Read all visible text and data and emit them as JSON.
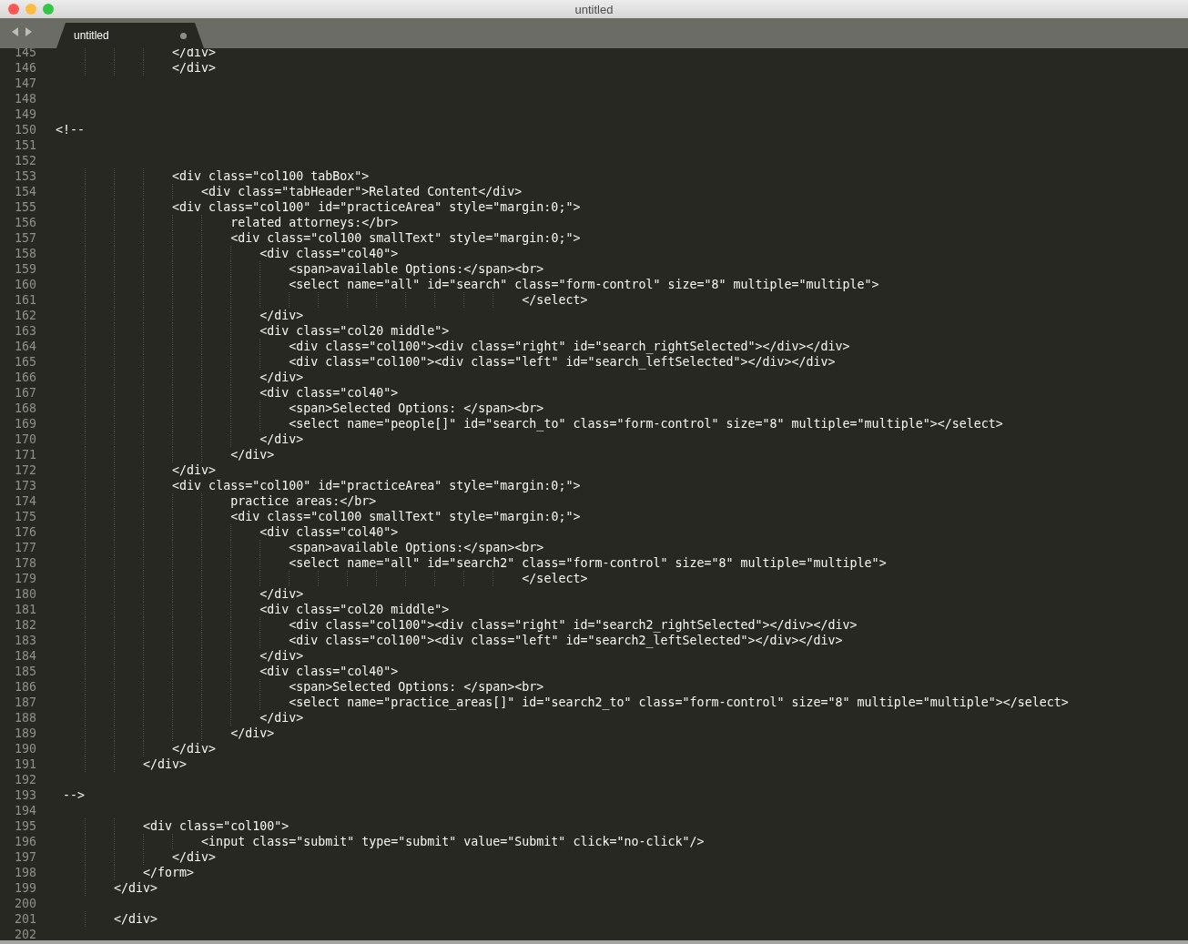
{
  "window": {
    "title": "untitled"
  },
  "tab": {
    "label": "untitled",
    "modified": true,
    "selected": true
  },
  "lines": [
    {
      "number": "145",
      "code": "                </div>"
    },
    {
      "number": "146",
      "code": "                </div>"
    },
    {
      "number": "147"
    },
    {
      "number": "148"
    },
    {
      "number": "149"
    },
    {
      "number": "150",
      "code": "<!--"
    },
    {
      "number": "151"
    },
    {
      "number": "152"
    },
    {
      "number": "153",
      "code": "                <div class=\"col100 tabBox\">"
    },
    {
      "number": "154",
      "code": "                    <div class=\"tabHeader\">Related Content</div>"
    },
    {
      "number": "155",
      "code": "                <div class=\"col100\" id=\"practiceArea\" style=\"margin:0;\">"
    },
    {
      "number": "156",
      "code": "                        related attorneys:</br>"
    },
    {
      "number": "157",
      "code": "                        <div class=\"col100 smallText\" style=\"margin:0;\">"
    },
    {
      "number": "158",
      "code": "                            <div class=\"col40\">"
    },
    {
      "number": "159",
      "code": "                                <span>available Options:</span><br>"
    },
    {
      "number": "160",
      "code": "                                <select name=\"all\" id=\"search\" class=\"form-control\" size=\"8\" multiple=\"multiple\">"
    },
    {
      "number": "161",
      "code": "                                                                </select>"
    },
    {
      "number": "162",
      "code": "                            </div>"
    },
    {
      "number": "163",
      "code": "                            <div class=\"col20 middle\">"
    },
    {
      "number": "164",
      "code": "                                <div class=\"col100\"><div class=\"right\" id=\"search_rightSelected\"></div></div>"
    },
    {
      "number": "165",
      "code": "                                <div class=\"col100\"><div class=\"left\" id=\"search_leftSelected\"></div></div>"
    },
    {
      "number": "166",
      "code": "                            </div>"
    },
    {
      "number": "167",
      "code": "                            <div class=\"col40\">"
    },
    {
      "number": "168",
      "code": "                                <span>Selected Options: </span><br>"
    },
    {
      "number": "169",
      "code": "                                <select name=\"people[]\" id=\"search_to\" class=\"form-control\" size=\"8\" multiple=\"multiple\"></select>"
    },
    {
      "number": "170",
      "code": "                            </div>"
    },
    {
      "number": "171",
      "code": "                        </div>"
    },
    {
      "number": "172",
      "code": "                </div>"
    },
    {
      "number": "173",
      "code": "                <div class=\"col100\" id=\"practiceArea\" style=\"margin:0;\">"
    },
    {
      "number": "174",
      "code": "                        practice areas:</br>"
    },
    {
      "number": "175",
      "code": "                        <div class=\"col100 smallText\" style=\"margin:0;\">"
    },
    {
      "number": "176",
      "code": "                            <div class=\"col40\">"
    },
    {
      "number": "177",
      "code": "                                <span>available Options:</span><br>"
    },
    {
      "number": "178",
      "code": "                                <select name=\"all\" id=\"search2\" class=\"form-control\" size=\"8\" multiple=\"multiple\">"
    },
    {
      "number": "179",
      "code": "                                                                </select>"
    },
    {
      "number": "180",
      "code": "                            </div>"
    },
    {
      "number": "181",
      "code": "                            <div class=\"col20 middle\">"
    },
    {
      "number": "182",
      "code": "                                <div class=\"col100\"><div class=\"right\" id=\"search2_rightSelected\"></div></div>"
    },
    {
      "number": "183",
      "code": "                                <div class=\"col100\"><div class=\"left\" id=\"search2_leftSelected\"></div></div>"
    },
    {
      "number": "184",
      "code": "                            </div>"
    },
    {
      "number": "185",
      "code": "                            <div class=\"col40\">"
    },
    {
      "number": "186",
      "code": "                                <span>Selected Options: </span><br>"
    },
    {
      "number": "187",
      "code": "                                <select name=\"practice_areas[]\" id=\"search2_to\" class=\"form-control\" size=\"8\" multiple=\"multiple\"></select>"
    },
    {
      "number": "188",
      "code": "                            </div>"
    },
    {
      "number": "189",
      "code": "                        </div>"
    },
    {
      "number": "190",
      "code": "                </div>"
    },
    {
      "number": "191",
      "code": "            </div>"
    },
    {
      "number": "192"
    },
    {
      "number": "193",
      "code": " -->"
    },
    {
      "number": "194"
    },
    {
      "number": "195",
      "code": "            <div class=\"col100\">"
    },
    {
      "number": "196",
      "code": "                    <input class=\"submit\" type=\"submit\" value=\"Submit\" click=\"no-click\"/>"
    },
    {
      "number": "197",
      "code": "                </div>"
    },
    {
      "number": "198",
      "code": "            </form>"
    },
    {
      "number": "199",
      "code": "        </div>"
    },
    {
      "number": "200"
    },
    {
      "number": "201",
      "code": "        </div>"
    },
    {
      "number": "202"
    }
  ]
}
